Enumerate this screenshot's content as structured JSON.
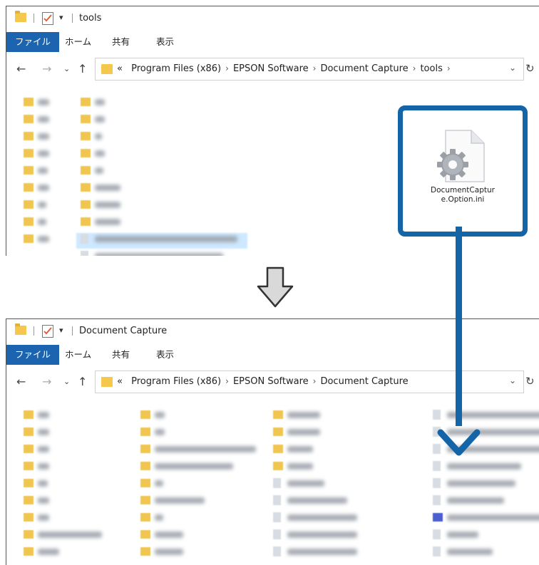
{
  "window1": {
    "title": "tools",
    "ribbon_tabs": [
      "ファイル",
      "ホーム",
      "共有",
      "表示"
    ],
    "breadcrumbs": [
      "«",
      "Program Files (x86)",
      "EPSON Software",
      "Document Capture",
      "tools"
    ],
    "icons": {
      "back": "back-arrow-icon",
      "forward": "forward-arrow-icon",
      "recent": "chevron-down-icon",
      "up": "up-arrow-icon",
      "refresh": "refresh-icon"
    }
  },
  "callout": {
    "file_name_line1": "DocumentCaptur",
    "file_name_line2": "e.Option.ini",
    "icon": "settings-file-icon",
    "border_color": "#1465a7"
  },
  "window2": {
    "title": "Document Capture",
    "ribbon_tabs": [
      "ファイル",
      "ホーム",
      "共有",
      "表示"
    ],
    "breadcrumbs": [
      "«",
      "Program Files (x86)",
      "EPSON Software",
      "Document Capture"
    ]
  },
  "colors": {
    "accent": "#1c64b0",
    "folder": "#f4c74d",
    "callout": "#1465a7"
  }
}
